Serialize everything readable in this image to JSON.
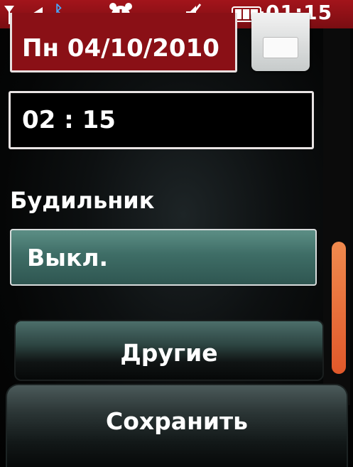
{
  "status_bar": {
    "time": "01:15",
    "icons": [
      "signal-icon",
      "bluetooth-icon",
      "alarm-clock-icon",
      "mute-icon",
      "battery-icon"
    ]
  },
  "form": {
    "date_value": "Пн 04/10/2010",
    "time_value": "02 : 15",
    "alarm_label": "Будильник",
    "alarm_value": "Выкл.",
    "other_button": "Другие",
    "save_button": "Сохранить"
  },
  "colors": {
    "status_bar": "#a3141b",
    "date_field": "#8a1016",
    "select": "#3e6d66",
    "scroll_thumb": "#e0582a"
  }
}
